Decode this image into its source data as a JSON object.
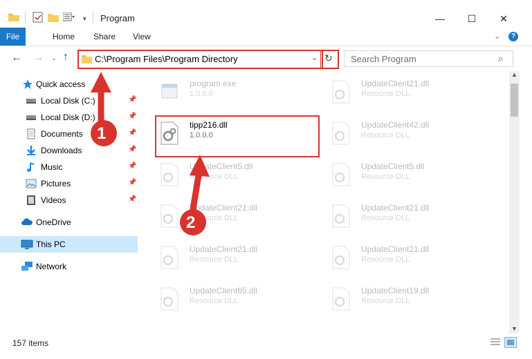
{
  "window": {
    "title": "Program",
    "minimize": "—",
    "maximize": "☐",
    "close": "✕"
  },
  "ribbon": {
    "tabs": [
      {
        "label": "File"
      },
      {
        "label": "Home"
      },
      {
        "label": "Share"
      },
      {
        "label": "View"
      }
    ],
    "help": "?"
  },
  "address": {
    "path": "C:\\Program Files\\Program Directory",
    "search_placeholder": "Search Program"
  },
  "sidebar": {
    "items": [
      {
        "label": "Quick access",
        "icon": "star-icon"
      },
      {
        "label": "Local Disk (C:)",
        "icon": "drive-icon",
        "pinned": true
      },
      {
        "label": "Local Disk (D:)",
        "icon": "drive-icon",
        "pinned": true
      },
      {
        "label": "Documents",
        "icon": "documents-icon",
        "pinned": true
      },
      {
        "label": "Downloads",
        "icon": "download-icon",
        "pinned": true
      },
      {
        "label": "Music",
        "icon": "music-icon",
        "pinned": true
      },
      {
        "label": "Pictures",
        "icon": "pictures-icon",
        "pinned": true
      },
      {
        "label": "Videos",
        "icon": "videos-icon",
        "pinned": true
      },
      {
        "label": "OneDrive",
        "icon": "cloud-icon"
      },
      {
        "label": "This PC",
        "icon": "computer-icon",
        "selected": true
      },
      {
        "label": "Network",
        "icon": "network-icon"
      }
    ]
  },
  "files": {
    "left": [
      {
        "name": "program.exe",
        "detail": "1.0.0.0"
      },
      {
        "name": "tipp216.dll",
        "detail": "1.0.0.0"
      },
      {
        "name": "UpdateClient5.dll",
        "detail": "Resource DLL"
      },
      {
        "name": "UpdateClient21.dll",
        "detail": "Resource DLL"
      },
      {
        "name": "UpdateClient21.dll",
        "detail": "Resource DLL"
      },
      {
        "name": "UpdateClient65.dll",
        "detail": "Resource DLL"
      }
    ],
    "right": [
      {
        "name": "UpdateClient21.dll",
        "detail": "Resource DLL"
      },
      {
        "name": "UpdateClient42.dll",
        "detail": "Resource DLL"
      },
      {
        "name": "UpdateClient5.dll",
        "detail": "Resource DLL"
      },
      {
        "name": "UpdateClient21.dll",
        "detail": "Resource DLL"
      },
      {
        "name": "UpdateClient21.dll",
        "detail": "Resource DLL"
      },
      {
        "name": "UpdateClient19.dll",
        "detail": "Resource DLL"
      }
    ]
  },
  "annotations": {
    "step1": "1",
    "step2": "2",
    "highlight_color": "#d9332f"
  },
  "status": {
    "count": "157 items"
  },
  "colors": {
    "accent": "#1979ca",
    "selected_bg": "#cce8ff",
    "callout": "#d9332f"
  }
}
